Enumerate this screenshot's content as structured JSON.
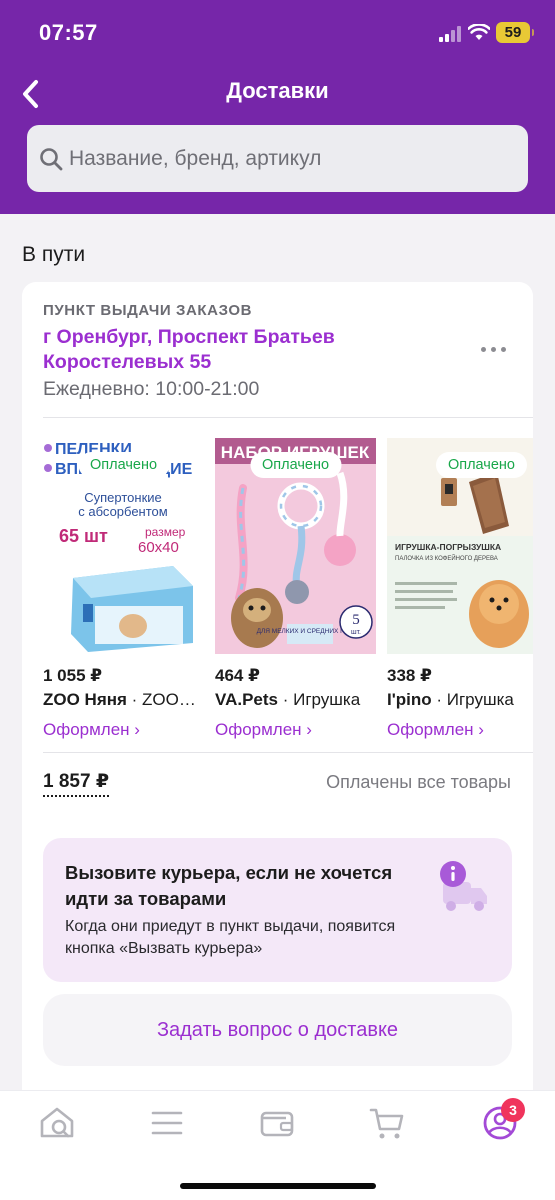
{
  "status_bar": {
    "time": "07:57",
    "battery": "59"
  },
  "header": {
    "title": "Доставки",
    "search_placeholder": "Название, бренд, артикул"
  },
  "section_title": "В пути",
  "order": {
    "pickup_label": "ПУНКТ ВЫДАЧИ ЗАКАЗОВ",
    "address": "г Оренбург, Проспект Братьев Коростелевых 55",
    "hours": "Ежедневно: 10:00-21:00",
    "products": [
      {
        "badge": "Оплачено",
        "price": "1 055 ₽",
        "brand": "ZOO Няня",
        "name": " · ZOO Няня",
        "status": "Оформлен ›",
        "thumb_lines": [
          "ПЕЛЕНКИ",
          "ВПИТЫВАЮЩИЕ",
          "Супертонкие",
          "с абсорбентом",
          "65 шт",
          "размер",
          "60х40"
        ]
      },
      {
        "badge": "Оплачено",
        "price": "464 ₽",
        "brand": "VA.Pets",
        "name": " · Игрушка",
        "status": "Оформлен ›",
        "thumb_lines": [
          "НАБОР ИГРУШЕК",
          "ДЛЯ МЕЛКИХ И СРЕДНИХ ПОРОД",
          "5",
          "шт."
        ]
      },
      {
        "badge": "Оплачено",
        "price": "338 ₽",
        "brand": "I'pino",
        "name": " · Игрушка",
        "status": "Оформлен ›",
        "thumb_lines": [
          "ИГРУШКА-ПОГРЫЗУШКА",
          "ПАЛОЧКА ИЗ КОФЕЙНОГО ДЕРЕВА"
        ]
      }
    ],
    "total": "1 857 ₽",
    "payment_status": "Оплачены все товары"
  },
  "courier_promo": {
    "title": "Вызовите курьера, если не хочется идти за товарами",
    "text": "Когда они приедут в пункт выдачи, появится кнопка «Вызвать курьера»"
  },
  "ask_button": "Задать вопрос о доставке",
  "tabbar": {
    "profile_badge": "3"
  },
  "colors": {
    "brand": "#7626a9",
    "accent": "#9b2fd0",
    "paid": "#19a74a",
    "badge": "#f0345c"
  }
}
